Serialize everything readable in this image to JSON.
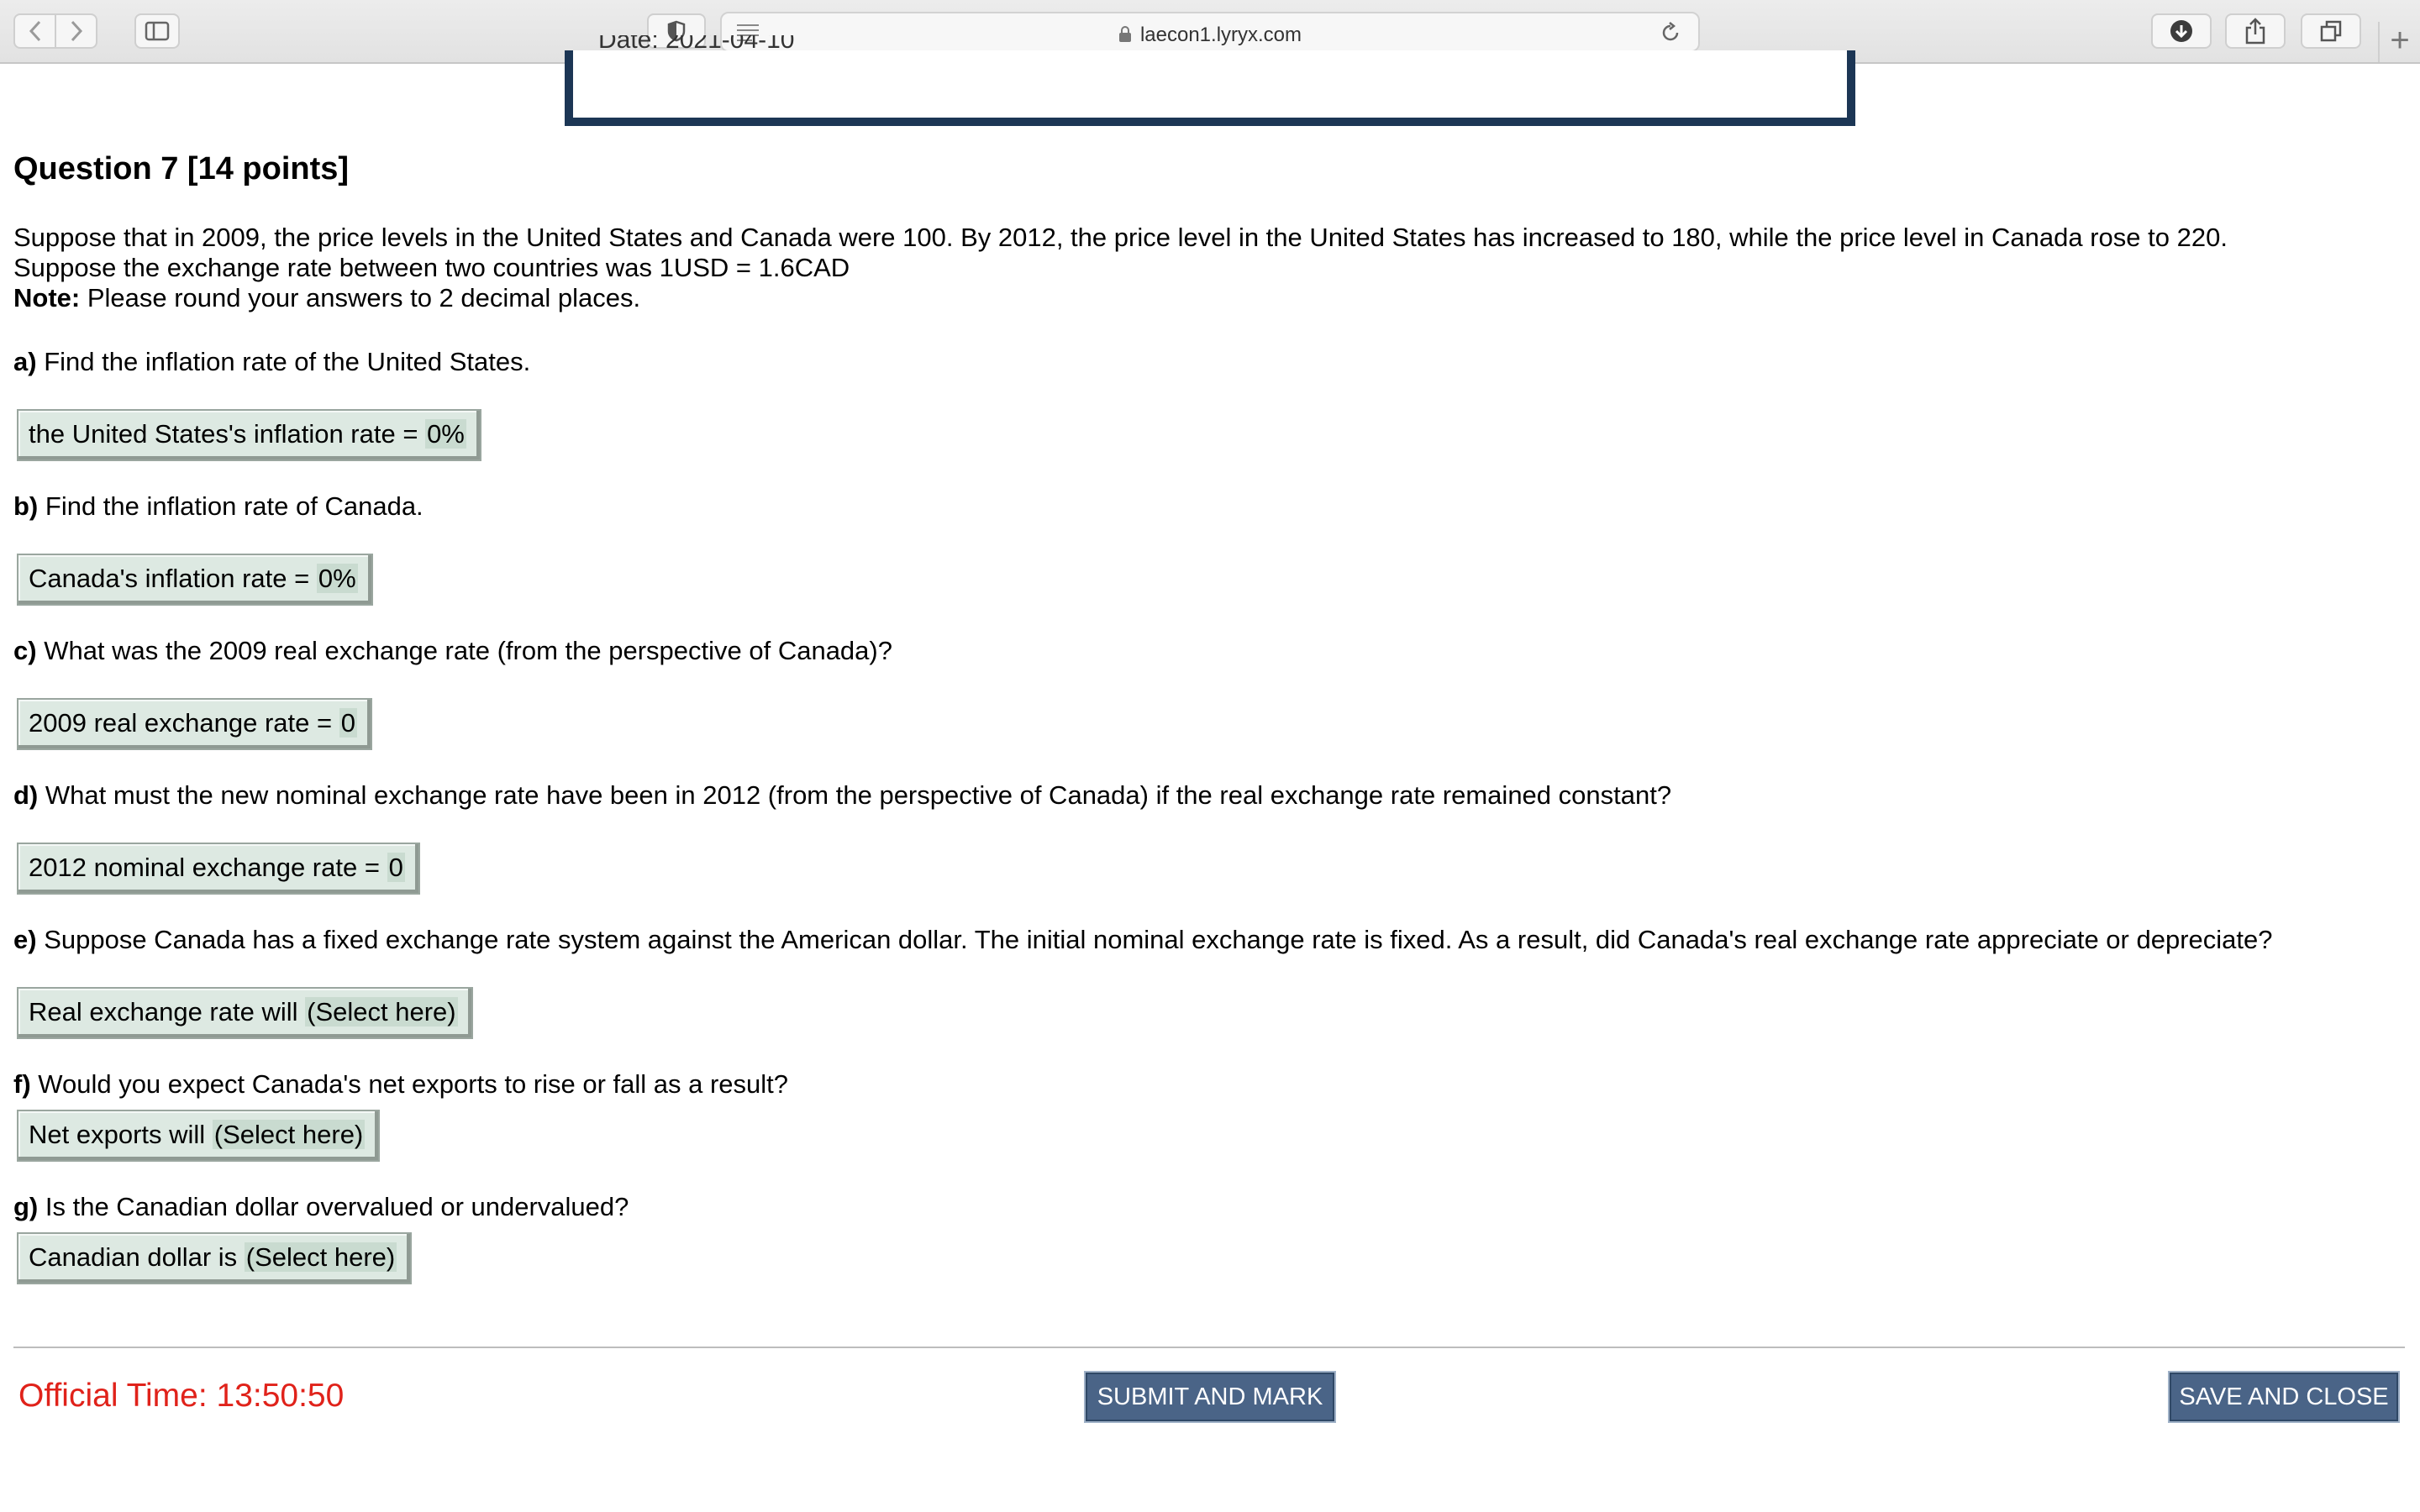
{
  "browser": {
    "url": "laecon1.lyryx.com",
    "new_tab": "+"
  },
  "header_box": {
    "date_text": "Date: 2021-04-10"
  },
  "question": {
    "title": "Question 7 [14 points]",
    "intro_line1": "Suppose that in 2009, the price levels in the United States and Canada were 100. By 2012, the price level in the United States has increased to 180, while the price level in Canada rose to 220.",
    "intro_line2": "Suppose the exchange rate between two countries was 1USD = 1.6CAD",
    "note_label": "Note:",
    "note_text": " Please round your answers to 2 decimal places.",
    "parts": [
      {
        "label": "a)",
        "text": " Find the inflation rate of the United States.",
        "answer_prefix": "the United States's inflation rate = ",
        "answer_value": "0%"
      },
      {
        "label": "b)",
        "text": " Find the inflation rate of Canada.",
        "answer_prefix": "Canada's inflation rate = ",
        "answer_value": "0%"
      },
      {
        "label": "c)",
        "text": " What was the 2009 real exchange rate (from the perspective of Canada)?",
        "answer_prefix": "2009 real exchange rate = ",
        "answer_value": "0"
      },
      {
        "label": "d)",
        "text": " What must the new nominal exchange rate have been in 2012 (from the perspective of Canada) if the real exchange rate remained constant?",
        "answer_prefix": "2012 nominal exchange rate = ",
        "answer_value": "0"
      },
      {
        "label": "e)",
        "text": " Suppose Canada has a fixed exchange rate system against the American dollar. The initial nominal exchange rate is fixed. As a result, did Canada's real exchange rate appreciate or depreciate?",
        "answer_prefix": "Real exchange rate will ",
        "answer_value": "(Select here)"
      },
      {
        "label": "f)",
        "text": " Would you expect Canada's net exports to rise or fall as a result?",
        "answer_prefix": "Net exports will ",
        "answer_value": "(Select here)"
      },
      {
        "label": "g)",
        "text": " Is the Canadian dollar overvalued or undervalued?",
        "answer_prefix": "Canadian dollar is ",
        "answer_value": "(Select here)"
      }
    ]
  },
  "footer": {
    "official_time": "Official Time: 13:50:50",
    "submit_label": "SUBMIT AND MARK",
    "save_label": "SAVE AND CLOSE"
  }
}
